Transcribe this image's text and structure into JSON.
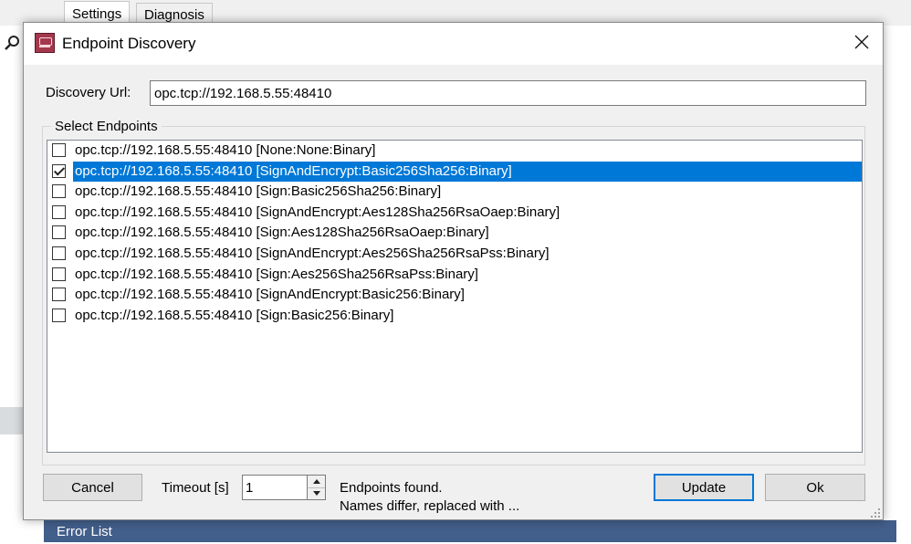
{
  "background": {
    "tabs": [
      {
        "label": "Settings"
      },
      {
        "label": "Diagnosis"
      }
    ],
    "error_list_label": "Error List",
    "search_icon": "search-icon"
  },
  "dialog": {
    "title": "Endpoint Discovery",
    "app_icon": "app-icon",
    "close_icon": "close-icon",
    "discovery_url": {
      "label": "Discovery Url:",
      "value": "opc.tcp://192.168.5.55:48410"
    },
    "endpoints_group": {
      "label": "Select Endpoints",
      "items": [
        {
          "text": "opc.tcp://192.168.5.55:48410 [None:None:Binary]",
          "checked": false,
          "selected": false
        },
        {
          "text": "opc.tcp://192.168.5.55:48410 [SignAndEncrypt:Basic256Sha256:Binary]",
          "checked": true,
          "selected": true
        },
        {
          "text": "opc.tcp://192.168.5.55:48410 [Sign:Basic256Sha256:Binary]",
          "checked": false,
          "selected": false
        },
        {
          "text": "opc.tcp://192.168.5.55:48410 [SignAndEncrypt:Aes128Sha256RsaOaep:Binary]",
          "checked": false,
          "selected": false
        },
        {
          "text": "opc.tcp://192.168.5.55:48410 [Sign:Aes128Sha256RsaOaep:Binary]",
          "checked": false,
          "selected": false
        },
        {
          "text": "opc.tcp://192.168.5.55:48410 [SignAndEncrypt:Aes256Sha256RsaPss:Binary]",
          "checked": false,
          "selected": false
        },
        {
          "text": "opc.tcp://192.168.5.55:48410 [Sign:Aes256Sha256RsaPss:Binary]",
          "checked": false,
          "selected": false
        },
        {
          "text": "opc.tcp://192.168.5.55:48410 [SignAndEncrypt:Basic256:Binary]",
          "checked": false,
          "selected": false
        },
        {
          "text": "opc.tcp://192.168.5.55:48410 [Sign:Basic256:Binary]",
          "checked": false,
          "selected": false
        }
      ]
    },
    "footer": {
      "cancel_label": "Cancel",
      "timeout_label": "Timeout [s]",
      "timeout_value": "1",
      "status_line1": "Endpoints found.",
      "status_line2": "Names differ, replaced with ...",
      "update_label": "Update",
      "ok_label": "Ok"
    }
  },
  "colors": {
    "selection": "#0078d7",
    "dialog_bg": "#f0f0f0",
    "error_list_bar": "#425e8a"
  }
}
